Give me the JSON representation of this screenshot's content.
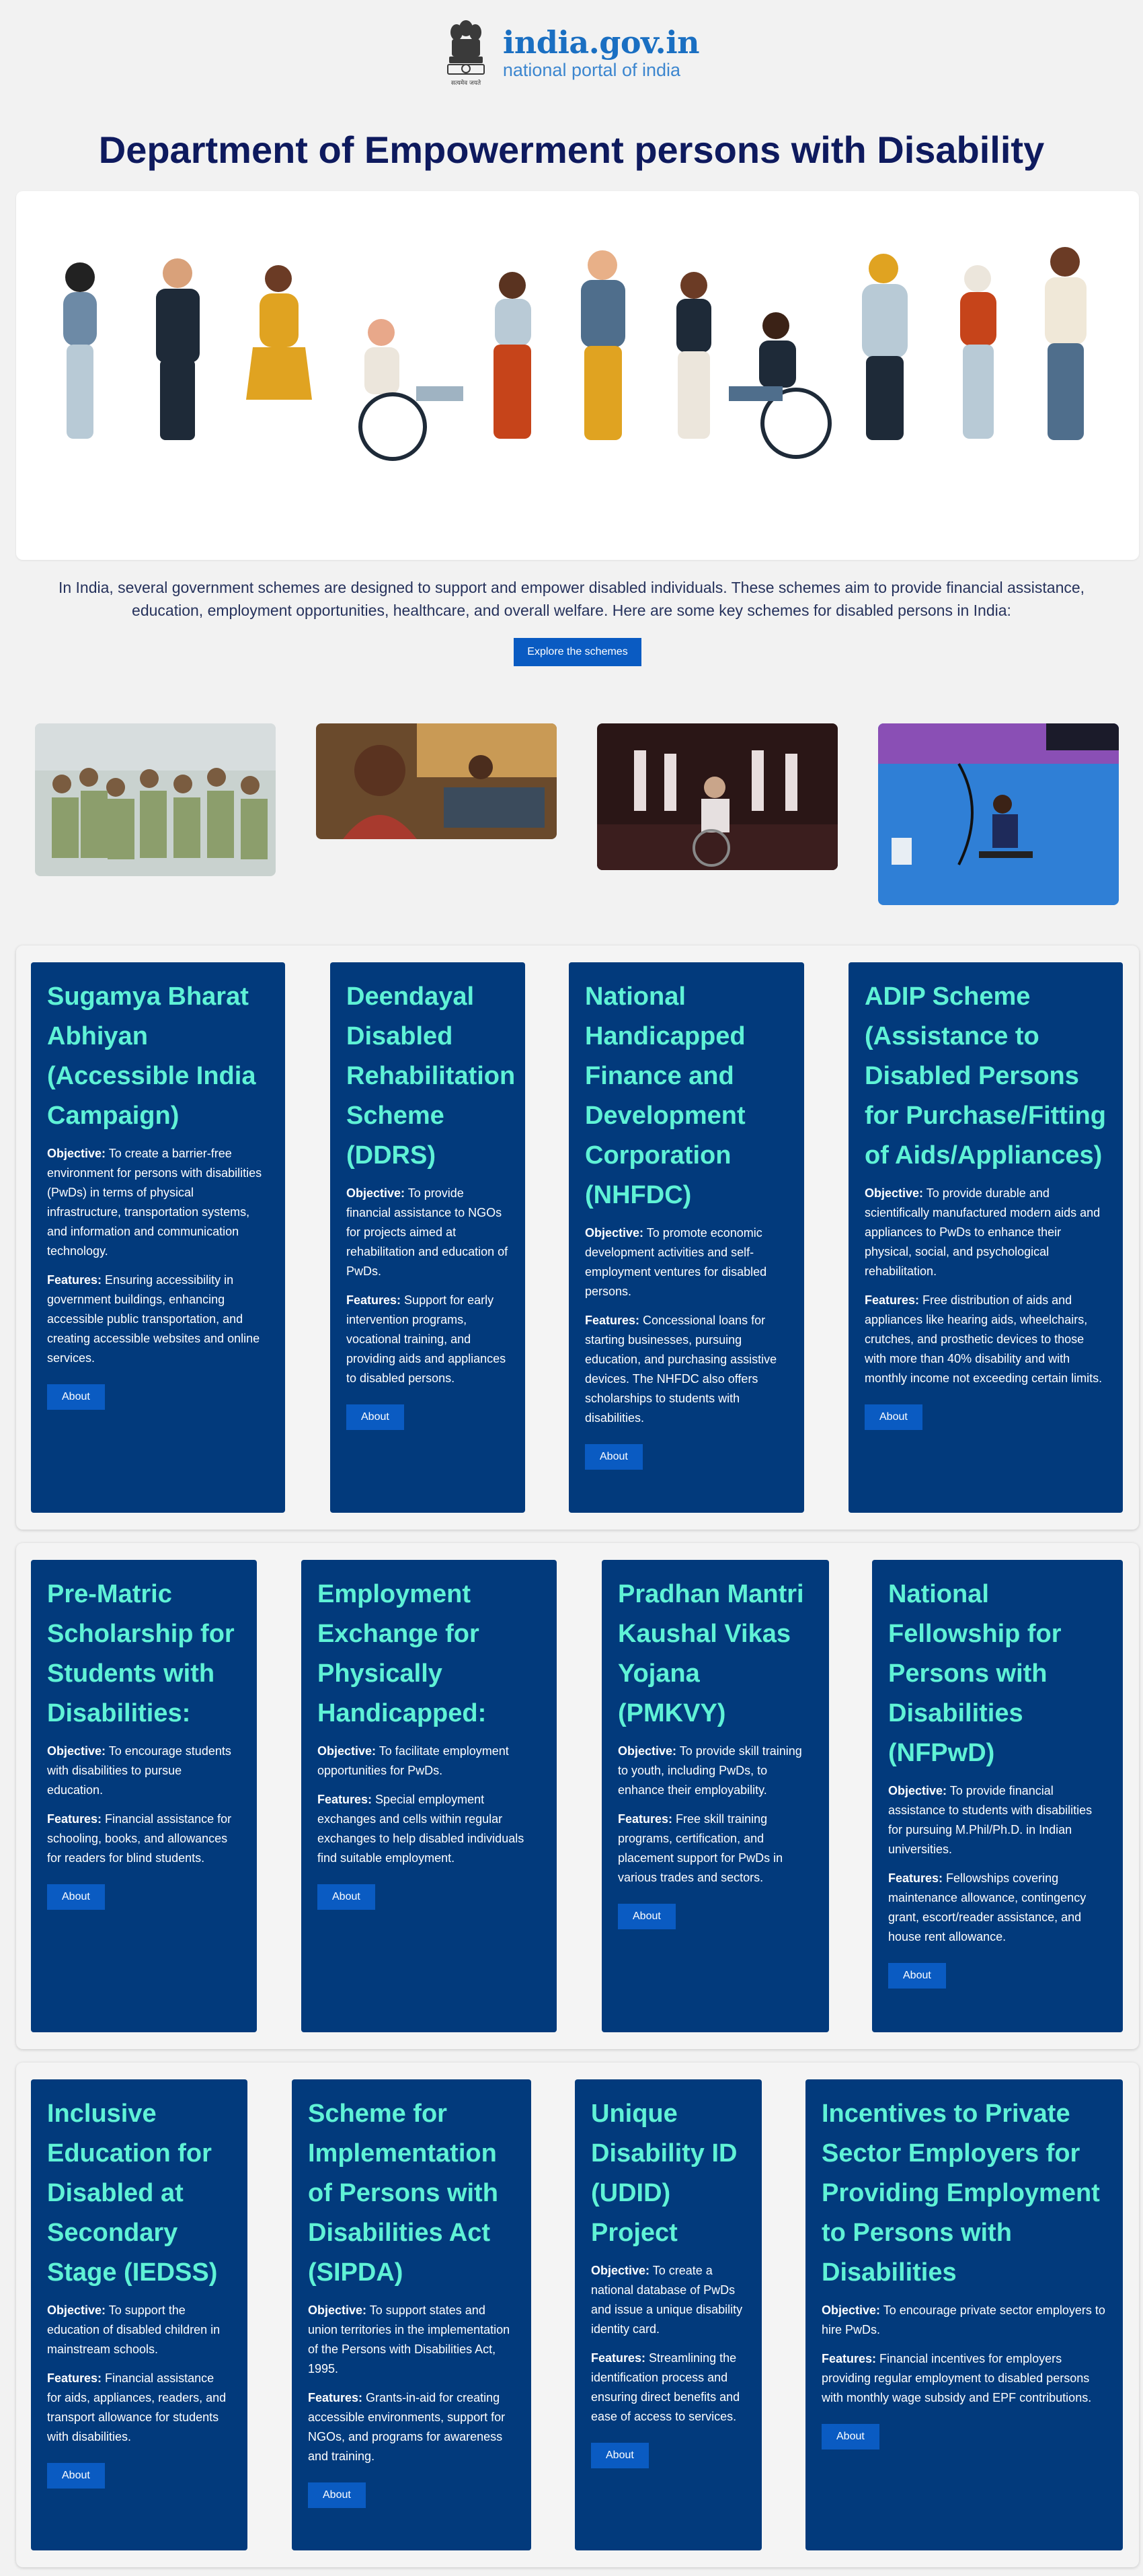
{
  "header": {
    "brand_name": "india.gov.in",
    "brand_sub": "national portal of india",
    "emblem_caption": "सत्यमेव जयते"
  },
  "page_title": "Department of Empowerment persons with Disability",
  "intro": "In India, several government schemes are designed to support and empower disabled individuals. These schemes aim to provide financial assistance, education, employment opportunities, healthcare, and overall welfare. Here are some key schemes for disabled persons in India:",
  "explore_label": "Explore the schemes",
  "labels": {
    "objective": "Objective:",
    "features": "Features:",
    "about": "About"
  },
  "schemes": [
    {
      "title": "Sugamya Bharat Abhiyan (Accessible India Campaign)",
      "objective": "To create a barrier-free environment for persons with disabilities (PwDs) in terms of physical infrastructure, transportation systems, and information and communication technology.",
      "features": "Ensuring accessibility in government buildings, enhancing accessible public transportation, and creating accessible websites and online services."
    },
    {
      "title": "Deendayal Disabled Rehabilitation Scheme (DDRS)",
      "objective": "To provide financial assistance to NGOs for projects aimed at rehabilitation and education of PwDs.",
      "features": "Support for early intervention programs, vocational training, and providing aids and appliances to disabled persons."
    },
    {
      "title": "National Handicapped Finance and Development Corporation (NHFDC)",
      "objective": "To promote economic development activities and self-employment ventures for disabled persons.",
      "features": "Concessional loans for starting businesses, pursuing education, and purchasing assistive devices. The NHFDC also offers scholarships to students with disabilities."
    },
    {
      "title": "ADIP Scheme (Assistance to Disabled Persons for Purchase/Fitting of Aids/Appliances)",
      "objective": "To provide durable and scientifically manufactured modern aids and appliances to PwDs to enhance their physical, social, and psychological rehabilitation.",
      "features": "Free distribution of aids and appliances like hearing aids, wheelchairs, crutches, and prosthetic devices to those with more than 40% disability and with monthly income not exceeding certain limits."
    },
    {
      "title": "Pre-Matric Scholarship for Students with Disabilities:",
      "objective": "To encourage students with disabilities to pursue education.",
      "features": "Financial assistance for schooling, books, and allowances for readers for blind students."
    },
    {
      "title": "Employment Exchange for Physically Handicapped:",
      "objective": "To facilitate employment opportunities for PwDs.",
      "features": "Special employment exchanges and cells within regular exchanges to help disabled individuals find suitable employment."
    },
    {
      "title": "Pradhan Mantri Kaushal Vikas Yojana (PMKVY)",
      "objective": "To provide skill training to youth, including PwDs, to enhance their employability.",
      "features": "Free skill training programs, certification, and placement support for PwDs in various trades and sectors."
    },
    {
      "title": "National Fellowship for Persons with Disabilities (NFPwD)",
      "objective": "To provide financial assistance to students with disabilities for pursuing M.Phil/Ph.D. in Indian universities.",
      "features": "Fellowships covering maintenance allowance, contingency grant, escort/reader assistance, and house rent allowance."
    },
    {
      "title": "Inclusive Education for Disabled at Secondary Stage (IEDSS)",
      "objective": "To support the education of disabled children in mainstream schools.",
      "features": "Financial assistance for aids, appliances, readers, and transport allowance for students with disabilities."
    },
    {
      "title": "Scheme for Implementation of Persons with Disabilities Act (SIPDA)",
      "objective": "To support states and union territories in the implementation of the Persons with Disabilities Act, 1995.",
      "features": "Grants-in-aid for creating accessible environments, support for NGOs, and programs for awareness and training."
    },
    {
      "title": "Unique Disability ID (UDID) Project",
      "objective": "To create a national database of PwDs and issue a unique disability identity card.",
      "features": "Streamlining the identification process and ensuring direct benefits and ease of access to services."
    },
    {
      "title": "Incentives to Private Sector Employers for Providing Employment to Persons with Disabilities",
      "objective": "To encourage private sector employers to hire PwDs.",
      "features": "Financial incentives for employers providing regular employment to disabled persons with monthly wage subsidy and EPF contributions."
    }
  ],
  "colors": {
    "card_bg": "#023a7c",
    "card_title": "#5ff2d6",
    "button": "#0a5bc2",
    "title": "#0e1a5e",
    "brand": "#1a6fc2"
  }
}
